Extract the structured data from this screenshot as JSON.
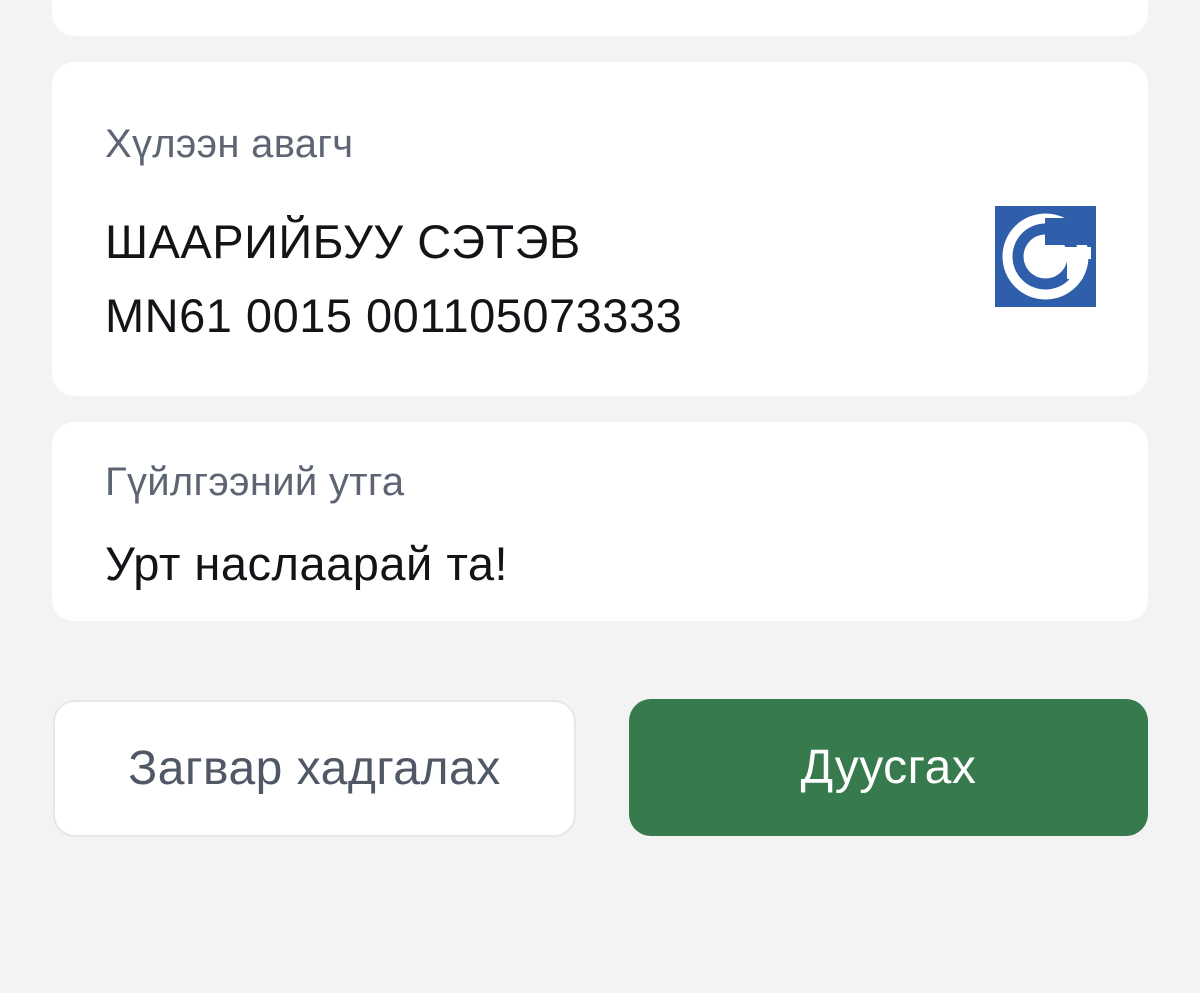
{
  "recipient": {
    "label": "Хүлээн авагч",
    "name": "ШААРИЙБУУ СЭТЭВ",
    "account": "MN61 0015 001105073333",
    "bank_icon": "golomt-bank-logo",
    "bank_color": "#2f5fab"
  },
  "description": {
    "label": "Гүйлгээний утга",
    "value": "Урт наслаарай та!"
  },
  "actions": {
    "save_template_label": "Загвар хадгалах",
    "finish_label": "Дуусгах",
    "finish_color": "#367a4e"
  }
}
